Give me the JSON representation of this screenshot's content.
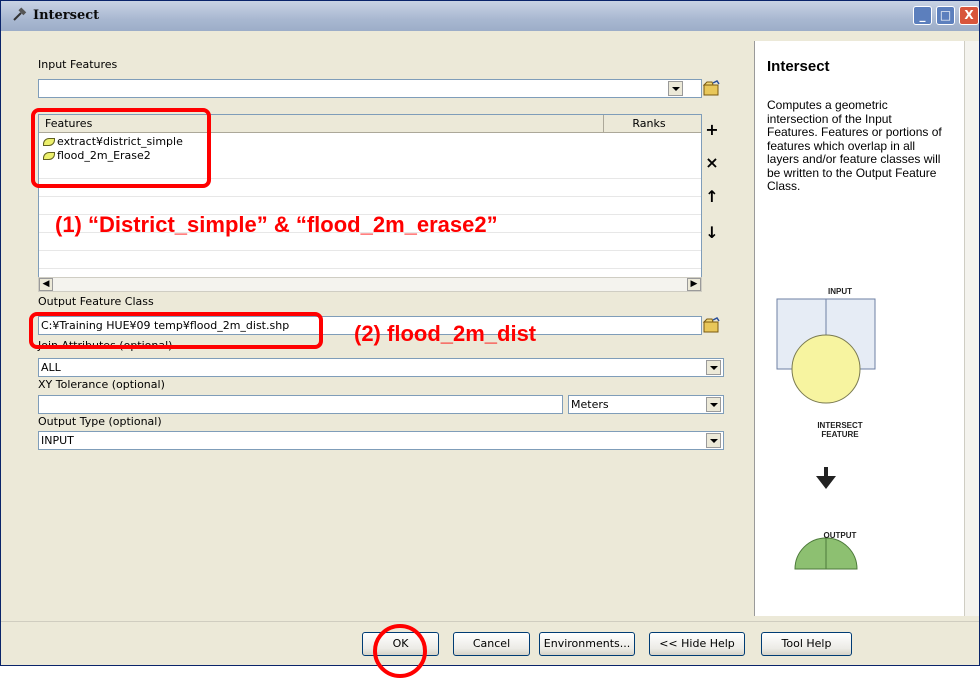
{
  "window": {
    "title": "Intersect"
  },
  "titlebar_buttons": {
    "minimize": "_",
    "maximize": "□",
    "close": "X"
  },
  "input_features": {
    "label": "Input Features",
    "value": "",
    "list_headers": {
      "features": "Features",
      "ranks": "Ranks"
    },
    "items": [
      {
        "name": "extract¥district_simple"
      },
      {
        "name": "flood_2m_Erase2"
      }
    ],
    "side_buttons": {
      "add": "+",
      "remove": "×",
      "up": "↑",
      "down": "↓"
    }
  },
  "output_feature_class": {
    "label": "Output Feature Class",
    "value": "C:¥Training HUE¥09 temp¥flood_2m_dist.shp"
  },
  "join_attributes": {
    "label": "Join Attributes (optional)",
    "value": "ALL"
  },
  "xy_tolerance": {
    "label": "XY Tolerance (optional)",
    "value": "",
    "unit": "Meters"
  },
  "output_type": {
    "label": "Output Type (optional)",
    "value": "INPUT"
  },
  "annotations": {
    "step1": "(1)  “District_simple” & “flood_2m_erase2”",
    "step2": "(2)  flood_2m_dist",
    "color": "#ff0000"
  },
  "help": {
    "title": "Intersect",
    "description": "Computes a geometric intersection of the Input Features. Features or portions of features which overlap in all layers and/or feature classes will be written to the Output Feature Class.",
    "diagram": {
      "input": "INPUT",
      "intersect_line1": "INTERSECT",
      "intersect_line2": "FEATURE",
      "output": "OUTPUT"
    }
  },
  "buttons": {
    "ok": "OK",
    "cancel": "Cancel",
    "environments": "Environments...",
    "hide_help": "<< Hide Help",
    "tool_help": "Tool Help"
  },
  "colors": {
    "title_bar": "#a9b8d1",
    "dialog_bg": "#ece9d8",
    "annotation": "#ff0000",
    "diagram_yellow": "#f7f4a0",
    "diagram_green": "#8dc071"
  }
}
